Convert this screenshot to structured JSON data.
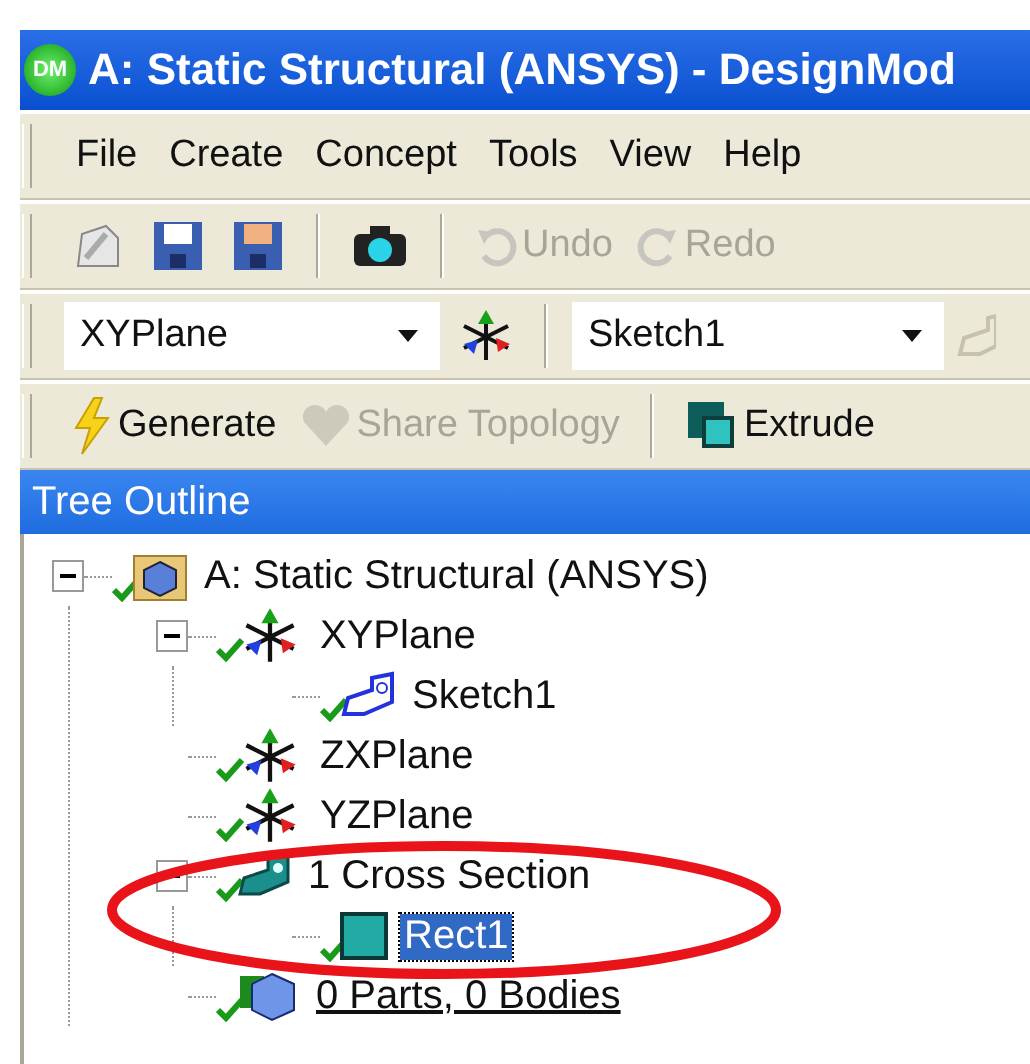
{
  "window": {
    "logo": "DM",
    "title": "A: Static Structural (ANSYS) - DesignMod"
  },
  "menu": [
    "File",
    "Create",
    "Concept",
    "Tools",
    "View",
    "Help"
  ],
  "toolbar": [
    {
      "kind": "new",
      "disabled": false
    },
    {
      "kind": "save",
      "disabled": false
    },
    {
      "kind": "saveas",
      "disabled": false
    },
    {
      "kind": "camera",
      "disabled": false
    },
    {
      "kind": "undo",
      "label": "Undo",
      "disabled": true
    },
    {
      "kind": "redo",
      "label": "Redo",
      "disabled": true
    }
  ],
  "plane_bar": {
    "plane": "XYPlane",
    "sketch": "Sketch1"
  },
  "feature_bar": [
    {
      "kind": "generate",
      "label": "Generate",
      "disabled": false
    },
    {
      "kind": "share",
      "label": "Share Topology",
      "disabled": true
    },
    {
      "kind": "extrude",
      "label": "Extrude",
      "disabled": false
    }
  ],
  "tree": {
    "header": "Tree Outline",
    "items": [
      {
        "label": "A: Static Structural (ANSYS)",
        "kind": "model",
        "expanded": true,
        "selected": false,
        "children": [
          {
            "label": "XYPlane",
            "kind": "plane",
            "expanded": true,
            "selected": false,
            "children": [
              {
                "label": "Sketch1",
                "kind": "sketch",
                "selected": false
              }
            ]
          },
          {
            "label": "ZXPlane",
            "kind": "plane",
            "selected": false
          },
          {
            "label": "YZPlane",
            "kind": "plane",
            "selected": false
          },
          {
            "label": "1 Cross Section",
            "kind": "section",
            "expanded": true,
            "selected": false,
            "children": [
              {
                "label": "Rect1",
                "kind": "rect",
                "selected": true
              }
            ]
          },
          {
            "label": "0 Parts, 0 Bodies",
            "kind": "bodies",
            "selected": false
          }
        ]
      }
    ]
  }
}
